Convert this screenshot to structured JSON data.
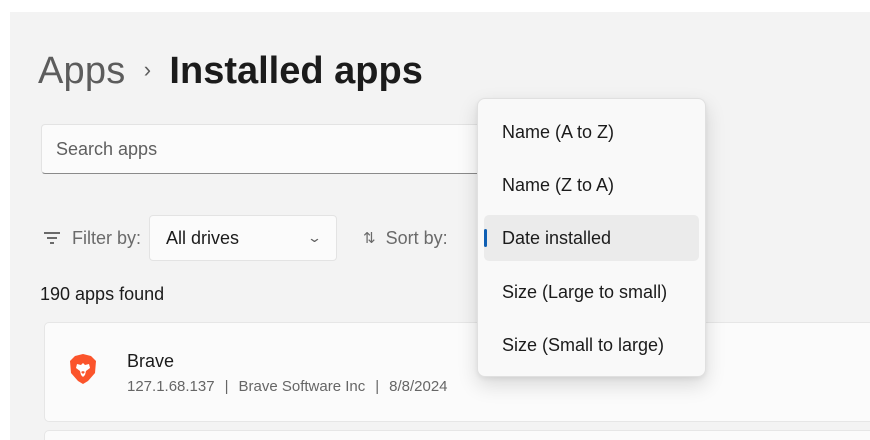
{
  "breadcrumb": {
    "parent": "Apps",
    "separator": "›",
    "current": "Installed apps"
  },
  "search": {
    "placeholder": "Search apps",
    "value": ""
  },
  "filter": {
    "label": "Filter by:",
    "selected": "All drives",
    "icon": "filter-icon"
  },
  "sort": {
    "label": "Sort by:",
    "icon": "sort-arrows-icon",
    "options": [
      "Name (A to Z)",
      "Name (Z to A)",
      "Date installed",
      "Size (Large to small)",
      "Size (Small to large)"
    ],
    "selected_index": 2
  },
  "apps_count": "190 apps found",
  "apps": [
    {
      "name": "Brave",
      "version": "127.1.68.137",
      "publisher": "Brave Software Inc",
      "date": "8/8/2024",
      "icon": "brave-lion-icon"
    }
  ],
  "colors": {
    "accent": "#0f5fb3",
    "brave_orange": "#fb542b"
  }
}
